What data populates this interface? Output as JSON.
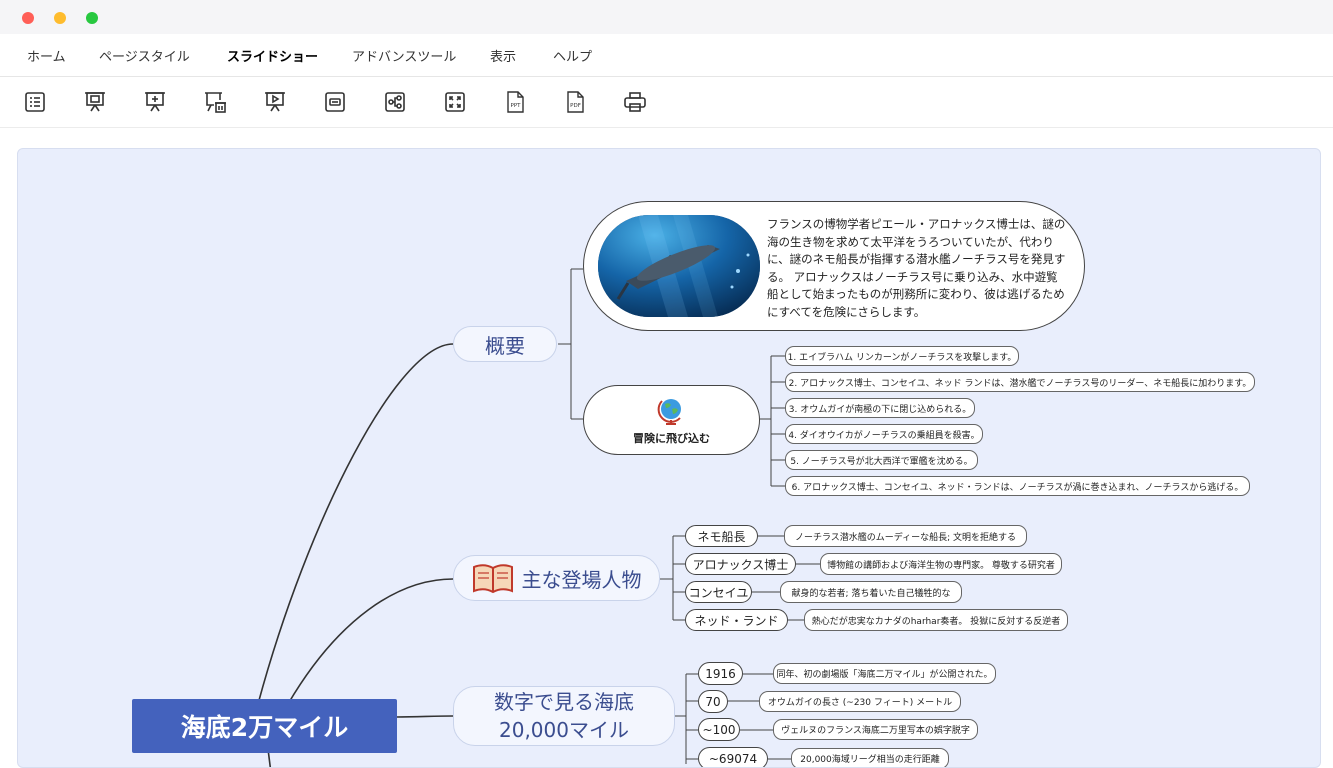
{
  "menu": {
    "items": [
      "ホーム",
      "ページスタイル",
      "スライドショー",
      "アドバンスツール",
      "表示",
      "ヘルプ"
    ],
    "active_index": 2
  },
  "toolbar": {
    "tools": [
      {
        "icon": "outline-icon"
      },
      {
        "icon": "slideshow-icon"
      },
      {
        "icon": "add-slide-icon"
      },
      {
        "icon": "delete-slide-icon"
      },
      {
        "icon": "play-icon"
      },
      {
        "icon": "collapse-icon"
      },
      {
        "icon": "branch-icon"
      },
      {
        "icon": "fullscreen-icon"
      },
      {
        "icon": "ppt-export-icon",
        "label": "PPT"
      },
      {
        "icon": "pdf-export-icon",
        "label": "PDF"
      },
      {
        "icon": "print-icon"
      }
    ]
  },
  "mindmap": {
    "root": "海底2万マイル",
    "overview": {
      "label": "概要",
      "summary": "フランスの博物学者ピエール・アロナックス博士は、謎の海の生き物を求めて太平洋をうろついていたが、代わりに、謎のネモ船長が指揮する潜水艦ノーチラス号を発見する。 アロナックスはノーチラス号に乗り込み、水中遊覧船として始まったものが刑務所に変わり、彼は逃げるためにすべてを危険にさらします。",
      "adventure": "冒険に飛び込む",
      "events": [
        "1. エイブラハム リンカーンがノーチラスを攻撃します。",
        "2. アロナックス博士、コンセイユ、ネッド ランドは、潜水艦でノーチラス号のリーダー、ネモ船長に加わります。",
        "3. オウムガイが南極の下に閉じ込められる。",
        "4. ダイオウイカがノーチラスの乗組員を殺害。",
        "5. ノーチラス号が北大西洋で軍艦を沈める。",
        "6. アロナックス博士、コンセイユ、ネッド・ランドは、ノーチラスが渦に巻き込まれ、ノーチラスから逃げる。"
      ]
    },
    "characters": {
      "label": "主な登場人物",
      "items": [
        {
          "name": "ネモ船長",
          "desc": "ノーチラス潜水艦のムーディーな船長; 文明を拒絶する"
        },
        {
          "name": "アロナックス博士",
          "desc": "博物館の講師および海洋生物の専門家。 尊敬する研究者"
        },
        {
          "name": "コンセイユ",
          "desc": "献身的な若者; 落ち着いた自己犠牲的な"
        },
        {
          "name": "ネッド・ランド",
          "desc": "熱心だが忠実なカナダのharhar奏者。 投獄に反対する反逆者"
        }
      ]
    },
    "numbers": {
      "label_line1": "数字で見る海底",
      "label_line2": "20,000マイル",
      "items": [
        {
          "value": "1916",
          "desc": "同年、初の劇場版「海底二万マイル」が公開された。"
        },
        {
          "value": "70",
          "desc": "オウムガイの長さ (~230 フィート) メートル"
        },
        {
          "value": "~100",
          "desc": "ヴェルヌのフランス海底二万里写本の娯字脱字"
        },
        {
          "value": "~69074",
          "desc": "20,000海域リーグ相当の走行距離"
        }
      ]
    }
  },
  "colors": {
    "root_bg": "#4462bd",
    "canvas_bg": "#e9eefc",
    "main_text": "#3b4d8f",
    "traffic": [
      "#ff5f57",
      "#febc2e",
      "#28c840"
    ]
  }
}
